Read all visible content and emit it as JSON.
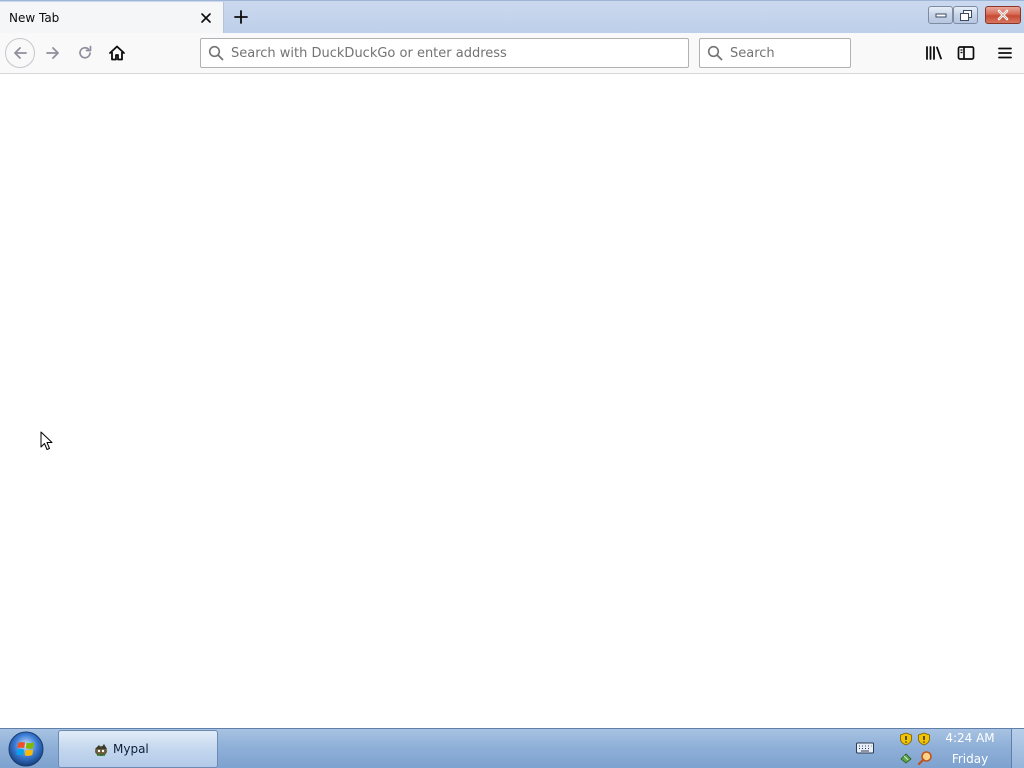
{
  "browser": {
    "tab": {
      "title": "New Tab"
    },
    "urlbar": {
      "placeholder": "Search with DuckDuckGo or enter address",
      "value": ""
    },
    "searchbar": {
      "placeholder": "Search",
      "value": ""
    },
    "icons": {
      "back": "back-arrow-icon",
      "forward": "forward-arrow-icon",
      "reload": "reload-icon",
      "home": "home-icon",
      "url_search": "search-icon",
      "library": "library-icon",
      "sidebar": "sidebar-icon",
      "menu": "hamburger-menu-icon",
      "new_tab": "plus-icon",
      "tab_close": "close-icon"
    }
  },
  "window_controls": {
    "icons": {
      "minimize": "minimize-icon",
      "restore": "restore-icon",
      "close": "close-icon"
    }
  },
  "taskbar": {
    "items": [
      {
        "label": "Mypal"
      }
    ],
    "clock": {
      "time": "4:24 AM",
      "day": "Friday"
    }
  },
  "colors": {
    "taskbar": "#8fb0d8",
    "toolbar": "#f9f9fa",
    "tabstrip": "#bdcfea",
    "close_button": "#c74a33"
  }
}
